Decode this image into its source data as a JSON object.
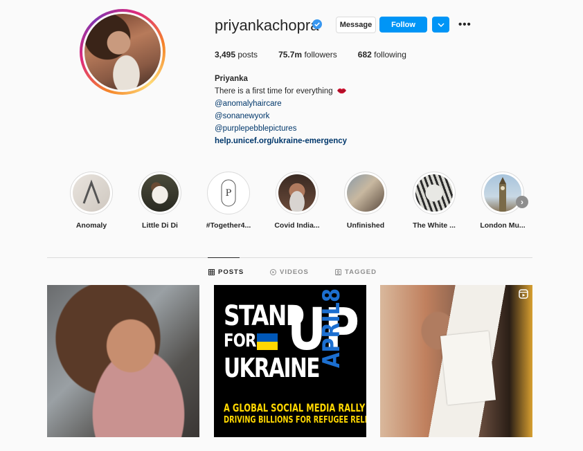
{
  "profile": {
    "username": "priyankachopra",
    "message_label": "Message",
    "follow_label": "Follow",
    "stats": [
      {
        "value": "3,495",
        "label": "posts"
      },
      {
        "value": "75.7m",
        "label": "followers"
      },
      {
        "value": "682",
        "label": "following"
      }
    ],
    "bio": {
      "name": "Priyanka",
      "line1": "There is a first time for everything",
      "mentions": [
        "@anomalyhaircare",
        "@sonanewyork",
        "@purplepebblepictures"
      ],
      "link": "help.unicef.org/ukraine-emergency"
    }
  },
  "highlights": [
    {
      "label": "Anomaly"
    },
    {
      "label": "Little Di Di"
    },
    {
      "label": "#Together4..."
    },
    {
      "label": "Covid India..."
    },
    {
      "label": "Unfinished"
    },
    {
      "label": "The White ..."
    },
    {
      "label": "London Mu..."
    }
  ],
  "tabs": [
    {
      "label": "POSTS",
      "active": true
    },
    {
      "label": "VIDEOS",
      "active": false
    },
    {
      "label": "TAGGED",
      "active": false
    }
  ],
  "posts": {
    "ukraine": {
      "line1": "STAND",
      "line2": "FOR",
      "line3": "UKRAINE",
      "up": "UP",
      "date": "APRIL8",
      "caption1": "A GLOBAL SOCIAL MEDIA RALLY",
      "caption2": "DRIVING BILLIONS FOR REFUGEE RELIEF"
    }
  },
  "colors": {
    "accent": "#0095f6",
    "link": "#00376b",
    "ukraine_blue": "#0057b7",
    "ukraine_yellow": "#ffd700",
    "date_blue": "#1c6fd0"
  }
}
